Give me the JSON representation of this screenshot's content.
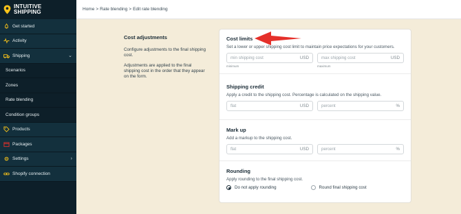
{
  "brand": {
    "line1": "INTUITIVE",
    "line2": "SHIPPING",
    "logo_color": "#f7c21a"
  },
  "sidebar": {
    "items": [
      {
        "label": "Get started",
        "icon": "rocket-icon",
        "type": "top"
      },
      {
        "label": "Activity",
        "icon": "pulse-icon",
        "type": "top"
      },
      {
        "label": "Shipping",
        "icon": "truck-icon",
        "type": "top",
        "expanded": true
      },
      {
        "label": "Scenarios",
        "type": "sub"
      },
      {
        "label": "Zones",
        "type": "sub"
      },
      {
        "label": "Rate blending",
        "type": "sub"
      },
      {
        "label": "Condition groups",
        "type": "sub"
      },
      {
        "label": "Products",
        "icon": "tag-icon",
        "type": "top"
      },
      {
        "label": "Packages",
        "icon": "box-icon",
        "type": "top"
      },
      {
        "label": "Settings",
        "icon": "gear-icon",
        "type": "top",
        "expandable": true
      },
      {
        "label": "Shopify connection",
        "icon": "link-icon",
        "type": "top"
      }
    ]
  },
  "breadcrumb": {
    "home": "Home",
    "sep": ">",
    "section": "Rate blending",
    "page": "Edit rate blending"
  },
  "description": {
    "title": "Cost adjustments",
    "p1": "Configure adjustments to the final shipping cost.",
    "p2": "Adjustments are applied to the final shipping cost in the order that they appear on the form."
  },
  "cost_limits": {
    "title": "Cost limits",
    "help": "Set a lower or upper shipping cost limit to maintain price expectations for your customers.",
    "min_placeholder": "min shipping cost",
    "max_placeholder": "max shipping cost",
    "unit": "USD",
    "min_label": "minimum",
    "max_label": "maximum"
  },
  "shipping_credit": {
    "title": "Shipping credit",
    "help": "Apply a credit to the shipping cost. Percentage is calculated on the shipping value.",
    "flat_placeholder": "flat",
    "flat_unit": "USD",
    "percent_placeholder": "percent",
    "percent_unit": "%"
  },
  "mark_up": {
    "title": "Mark up",
    "help": "Add a markup to the shipping cost.",
    "flat_placeholder": "flat",
    "flat_unit": "USD",
    "percent_placeholder": "percent",
    "percent_unit": "%"
  },
  "rounding": {
    "title": "Rounding",
    "help": "Apply rounding to the final shipping cost.",
    "option1": "Do not apply rounding",
    "option2": "Round final shipping cost",
    "selected": "option1"
  },
  "annotation": {
    "arrow_color": "#e5302a"
  }
}
